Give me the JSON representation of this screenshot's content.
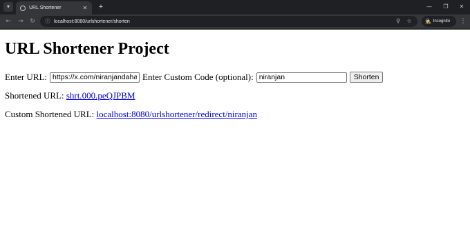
{
  "browser": {
    "tab_list_icon": "chevron-down-icon",
    "tab": {
      "title": "URL Shortener",
      "favicon": "globe-icon",
      "close_glyph": "✕"
    },
    "new_tab_glyph": "+",
    "window_controls": {
      "minimize": "—",
      "restore": "❐",
      "close": "✕"
    },
    "nav": {
      "back": "←",
      "forward": "→",
      "reload": "↻"
    },
    "address": "localhost:8080/urlshortener/shorten",
    "incognito_label": "Incognito",
    "colors": {
      "tabstrip": "#1f2023",
      "toolbar": "#35363a",
      "omnibox": "#202124"
    }
  },
  "page": {
    "title": "URL Shortener Project",
    "form": {
      "url_label": "Enter URL:",
      "url_value": "https://x.com/niranjandahal",
      "code_label": "Enter Custom Code (optional):",
      "code_value": "niranjan",
      "submit_label": "Shorten"
    },
    "shortened": {
      "label": "Shortened URL:",
      "link_text": "shrt.000.peQJPBM"
    },
    "custom": {
      "label": "Custom Shortened URL:",
      "link_text": "localhost:8080/urlshortener/redirect/niranjan"
    },
    "colors": {
      "link": "#0000ee",
      "text": "#000000",
      "background": "#ffffff"
    }
  }
}
